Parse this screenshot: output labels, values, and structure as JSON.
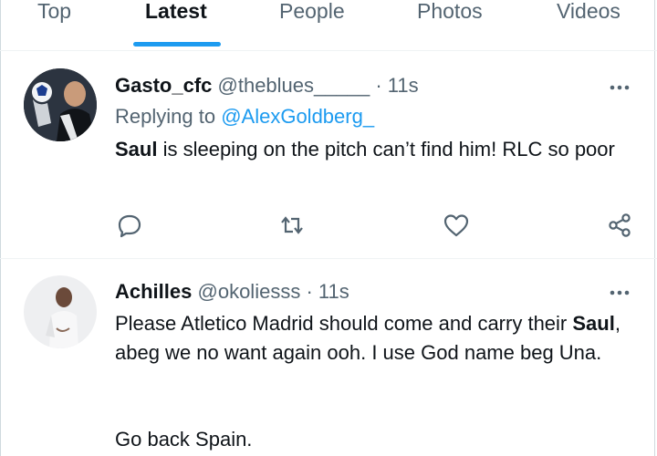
{
  "tabs": [
    {
      "label": "Top",
      "active": false
    },
    {
      "label": "Latest",
      "active": true
    },
    {
      "label": "People",
      "active": false
    },
    {
      "label": "Photos",
      "active": false
    },
    {
      "label": "Videos",
      "active": false
    }
  ],
  "colors": {
    "accent": "#1d9bf0",
    "text": "#0f1419",
    "secondary": "#536471",
    "divider": "#eff3f4"
  },
  "tweets": [
    {
      "display_name": "Gasto_cfc",
      "handle": "@theblues_____",
      "separator": " · ",
      "time": "11s",
      "replying_label": "Replying to",
      "replying_to": "@AlexGoldberg_",
      "text_bold": "Saul",
      "text_rest": " is sleeping on the pitch can’t find him! RLC so poor",
      "avatar_icon": "profile-photo"
    },
    {
      "display_name": "Achilles",
      "handle": "@okoliesss",
      "separator": " · ",
      "time": "11s",
      "text_pre": "Please Atletico Madrid should come and carry their ",
      "text_bold": "Saul",
      "text_rest": ", abeg we no want again ooh. I use God name beg Una.",
      "text_line2": "Go back Spain.",
      "avatar_icon": "profile-photo"
    }
  ],
  "icons": {
    "reply": "comment-icon",
    "retweet": "retweet-icon",
    "like": "heart-icon",
    "share": "share-icon",
    "more": "more-options-icon"
  }
}
